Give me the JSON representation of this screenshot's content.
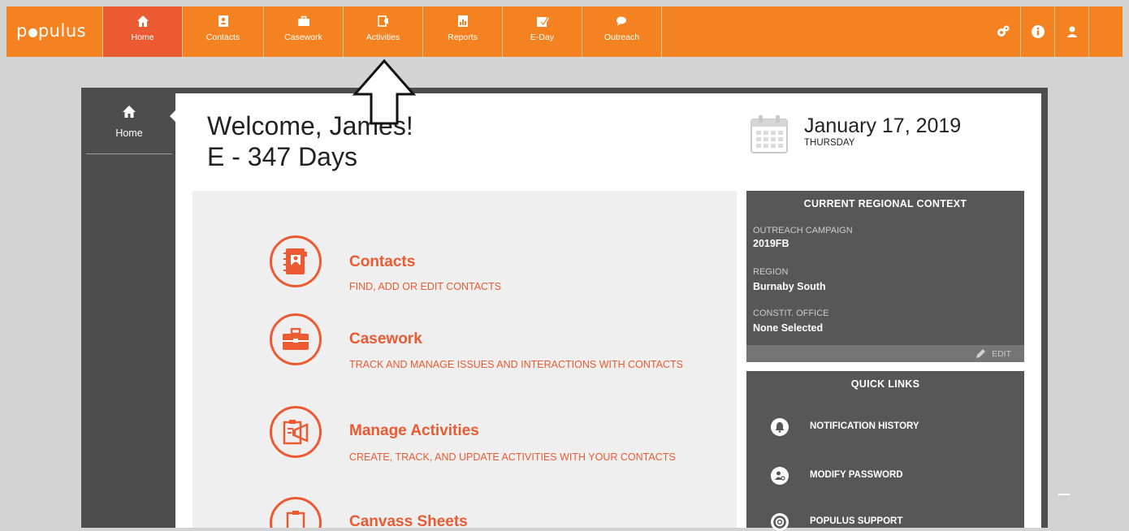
{
  "app": {
    "logo": "populus",
    "brand_color": "#f58220",
    "active_color": "#ec5a31"
  },
  "nav": {
    "items": [
      {
        "label": "Home",
        "icon": "home-icon"
      },
      {
        "label": "Contacts",
        "icon": "contacts-book-icon"
      },
      {
        "label": "Casework",
        "icon": "briefcase-icon"
      },
      {
        "label": "Activities",
        "icon": "activities-icon"
      },
      {
        "label": "Reports",
        "icon": "reports-icon"
      },
      {
        "label": "E-Day",
        "icon": "calendar-check-icon"
      },
      {
        "label": "Outreach",
        "icon": "chat-bubbles-icon"
      }
    ],
    "active": "Home",
    "right_icons": [
      "gears-icon",
      "info-icon",
      "user-icon"
    ]
  },
  "sidebar": {
    "home_label": "Home"
  },
  "header": {
    "welcome": "Welcome, James!",
    "countdown": "E - 347 Days",
    "date": "January 17, 2019",
    "weekday": "THURSDAY"
  },
  "tiles": [
    {
      "title": "Contacts",
      "desc": "FIND, ADD OR EDIT CONTACTS",
      "icon": "contacts-book-icon"
    },
    {
      "title": "Casework",
      "desc": "TRACK AND MANAGE ISSUES AND INTERACTIONS WITH CONTACTS",
      "icon": "briefcase-icon"
    },
    {
      "title": "Manage Activities",
      "desc": "CREATE, TRACK, AND UPDATE ACTIVITIES WITH YOUR CONTACTS",
      "icon": "megaphone-clipboard-icon"
    },
    {
      "title": "Canvass Sheets",
      "icon": "clipboard-icon"
    }
  ],
  "context": {
    "title": "CURRENT REGIONAL CONTEXT",
    "campaign_label": "OUTREACH CAMPAIGN",
    "campaign_value": "2019FB",
    "region_label": "REGION",
    "region_value": "Burnaby South",
    "office_label": "CONSTIT. OFFICE",
    "office_value": "None Selected",
    "edit_label": "EDIT"
  },
  "quick_links": {
    "title": "QUICK LINKS",
    "items": [
      {
        "label": "NOTIFICATION HISTORY",
        "icon": "bell-icon"
      },
      {
        "label": "MODIFY PASSWORD",
        "icon": "user-key-icon"
      },
      {
        "label": "POPULUS SUPPORT",
        "icon": "lifebuoy-icon"
      }
    ]
  }
}
